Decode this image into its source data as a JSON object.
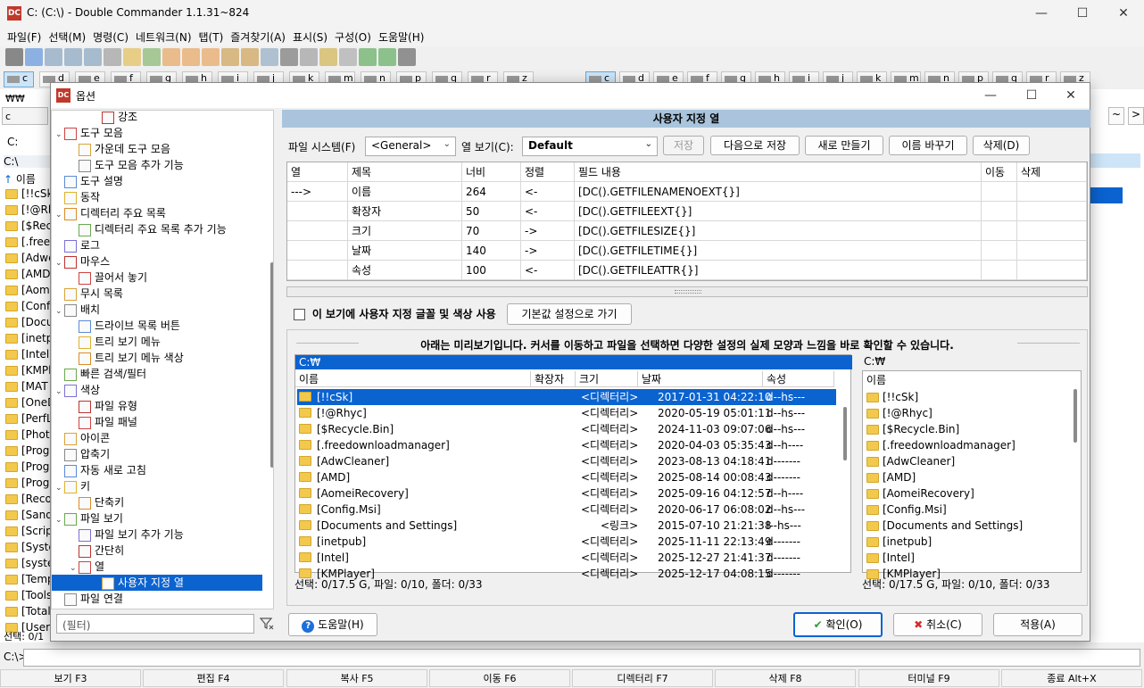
{
  "window": {
    "title": "C: (C:\\) - Double Commander 1.1.31~824",
    "logo": "DC",
    "controls": [
      "—",
      "☐",
      "✕"
    ]
  },
  "menu": [
    "파일(F)",
    "선택(M)",
    "명령(C)",
    "네트워크(N)",
    "탭(T)",
    "즐겨찾기(A)",
    "표시(S)",
    "구성(O)",
    "도움말(H)"
  ],
  "drives_left": [
    "c",
    "d",
    "e",
    "f",
    "g",
    "h",
    "i",
    "j",
    "k",
    "m",
    "n",
    "p",
    "q",
    "r",
    "z"
  ],
  "drives_right": [
    "c",
    "d",
    "e",
    "f",
    "g",
    "h",
    "i",
    "j",
    "k",
    "m",
    "n",
    "p",
    "q",
    "r",
    "z"
  ],
  "background_left": {
    "path": "C:",
    "current": "C:\\",
    "header": "이름",
    "rows": [
      "[!!cSk]",
      "[!@Rh",
      "[$Recy",
      "[.freed",
      "[Adwc",
      "[AMD]",
      "[Aome",
      "[Confi",
      "[Docu",
      "[inetp",
      "[Intel]",
      "[KMPl",
      "[MAT",
      "[OneD",
      "[PerfL",
      "[Phot",
      "[Prog",
      "[Prog",
      "[Prog",
      "[Reco",
      "[Sand",
      "[Scrip",
      "[Syste",
      "[syste",
      "[Temp",
      "[Tools",
      "[Total",
      "[Users"
    ],
    "status": "선택: 0/1"
  },
  "bgdrive_label": "₩₩",
  "cmdline_label": "C:\\>",
  "fkeys": [
    "보기 F3",
    "편집 F4",
    "복사 F5",
    "이동 F6",
    "디렉터리 F7",
    "삭제 F8",
    "터미널 F9",
    "종료 Alt+X"
  ],
  "dialog": {
    "title": "옵션",
    "tree": [
      {
        "label": "강조",
        "level": 2
      },
      {
        "label": "도구 모음",
        "level": 0,
        "exp": "⌄"
      },
      {
        "label": "가운데 도구 모음",
        "level": 1
      },
      {
        "label": "도구 모음 추가 기능",
        "level": 1
      },
      {
        "label": "도구 설명",
        "level": 0
      },
      {
        "label": "동작",
        "level": 0
      },
      {
        "label": "디렉터리 주요 목록",
        "level": 0,
        "exp": "⌄"
      },
      {
        "label": "디렉터리 주요 목록 추가 기능",
        "level": 1
      },
      {
        "label": "로그",
        "level": 0
      },
      {
        "label": "마우스",
        "level": 0,
        "exp": "⌄"
      },
      {
        "label": "끌어서 놓기",
        "level": 1
      },
      {
        "label": "무시 목록",
        "level": 0
      },
      {
        "label": "배치",
        "level": 0,
        "exp": "⌄"
      },
      {
        "label": "드라이브 목록 버튼",
        "level": 1
      },
      {
        "label": "트리 보기 메뉴",
        "level": 1
      },
      {
        "label": "트리 보기 메뉴 색상",
        "level": 1
      },
      {
        "label": "빠른 검색/필터",
        "level": 0
      },
      {
        "label": "색상",
        "level": 0,
        "exp": "⌄"
      },
      {
        "label": "파일 유형",
        "level": 1
      },
      {
        "label": "파일 패널",
        "level": 1
      },
      {
        "label": "아이콘",
        "level": 0
      },
      {
        "label": "압축기",
        "level": 0
      },
      {
        "label": "자동 새로 고침",
        "level": 0
      },
      {
        "label": "키",
        "level": 0,
        "exp": "⌄"
      },
      {
        "label": "단축키",
        "level": 1
      },
      {
        "label": "파일 보기",
        "level": 0,
        "exp": "⌄"
      },
      {
        "label": "파일 보기 추가 기능",
        "level": 1
      },
      {
        "label": "간단히",
        "level": 1
      },
      {
        "label": "열",
        "level": 1,
        "exp": "⌄"
      },
      {
        "label": "사용자 지정 열",
        "level": 2,
        "selected": true
      },
      {
        "label": "파일 연결",
        "level": 0
      }
    ],
    "filter_placeholder": "(필터)",
    "help_button": "도움말(H)",
    "ok_button": "확인(O)",
    "cancel_button": "취소(C)",
    "apply_button": "적용(A)",
    "page_title": "사용자 지정 열",
    "fs_label": "파일 시스템(F)",
    "fs_value": "<General>",
    "view_label": "열 보기(C):",
    "view_value": "Default",
    "save_button": "저장",
    "save_as_button": "다음으로 저장",
    "new_button": "새로 만들기",
    "rename_button": "이름 바꾸기",
    "delete_button": "삭제(D)",
    "grid_headers": [
      "열",
      "제목",
      "너비",
      "정렬",
      "필드 내용",
      "이동",
      "삭제"
    ],
    "grid_rows": [
      [
        "--->",
        "이름",
        "264",
        "<-",
        "[DC().GETFILENAMENOEXT{}]"
      ],
      [
        "",
        "확장자",
        "50",
        "<-",
        "[DC().GETFILEEXT{}]"
      ],
      [
        "",
        "크기",
        "70",
        "->",
        "[DC().GETFILESIZE{}]"
      ],
      [
        "",
        "날짜",
        "140",
        "->",
        "[DC().GETFILETIME{}]"
      ],
      [
        "",
        "속성",
        "100",
        "<-",
        "[DC().GETFILEATTR{}]"
      ]
    ],
    "custom_font_label": "이 보기에 사용자 지정 글꼴 및 색상 사용",
    "reset_button": "기본값 설정으로 가기",
    "preview_note": "아래는 미리보기입니다. 커서를 이동하고 파일을 선택하면 다양한 설정의 실제 모양과 느낌을 바로 확인할 수 있습니다.",
    "preview_left": {
      "path": "C:₩",
      "headers": [
        "이름",
        "확장자",
        "크기",
        "날짜",
        "속성"
      ],
      "rows": [
        [
          "[!!cSk]",
          "",
          "<디렉터리>",
          "2017-01-31 04:22:10",
          "d--hs---"
        ],
        [
          "[!@Rhyc]",
          "",
          "<디렉터리>",
          "2020-05-19 05:01:11",
          "d--hs---"
        ],
        [
          "[$Recycle.Bin]",
          "",
          "<디렉터리>",
          "2024-11-03 09:07:06",
          "d--hs---"
        ],
        [
          "[.freedownloadmanager]",
          "",
          "<디렉터리>",
          "2020-04-03 05:35:43",
          "d--h----"
        ],
        [
          "[AdwCleaner]",
          "",
          "<디렉터리>",
          "2023-08-13 04:18:41",
          "d-------"
        ],
        [
          "[AMD]",
          "",
          "<디렉터리>",
          "2025-08-14 00:08:43",
          "d-------"
        ],
        [
          "[AomeiRecovery]",
          "",
          "<디렉터리>",
          "2025-09-16 04:12:57",
          "d--h----"
        ],
        [
          "[Config.Msi]",
          "",
          "<디렉터리>",
          "2020-06-17 06:08:02",
          "d--hs---"
        ],
        [
          "[Documents and Settings]",
          "",
          "<링크>",
          "2015-07-10 21:21:38",
          "l--hs---"
        ],
        [
          "[inetpub]",
          "",
          "<디렉터리>",
          "2025-11-11 22:13:49",
          "d-------"
        ],
        [
          "[Intel]",
          "",
          "<디렉터리>",
          "2025-12-27 21:41:37",
          "d-------"
        ],
        [
          "[KMPlayer]",
          "",
          "<디렉터리>",
          "2025-12-17 04:08:15",
          "d-------"
        ]
      ],
      "status": "선택: 0/17.5 G, 파일: 0/10, 폴더: 0/33"
    },
    "preview_right": {
      "path": "C:₩",
      "header": "이름",
      "rows": [
        "[!!cSk]",
        "[!@Rhyc]",
        "[$Recycle.Bin]",
        "[.freedownloadmanager]",
        "[AdwCleaner]",
        "[AMD]",
        "[AomeiRecovery]",
        "[Config.Msi]",
        "[Documents and Settings]",
        "[inetpub]",
        "[Intel]",
        "[KMPlayer]"
      ],
      "status": "선택: 0/17.5 G, 파일: 0/10, 폴더: 0/33"
    }
  }
}
